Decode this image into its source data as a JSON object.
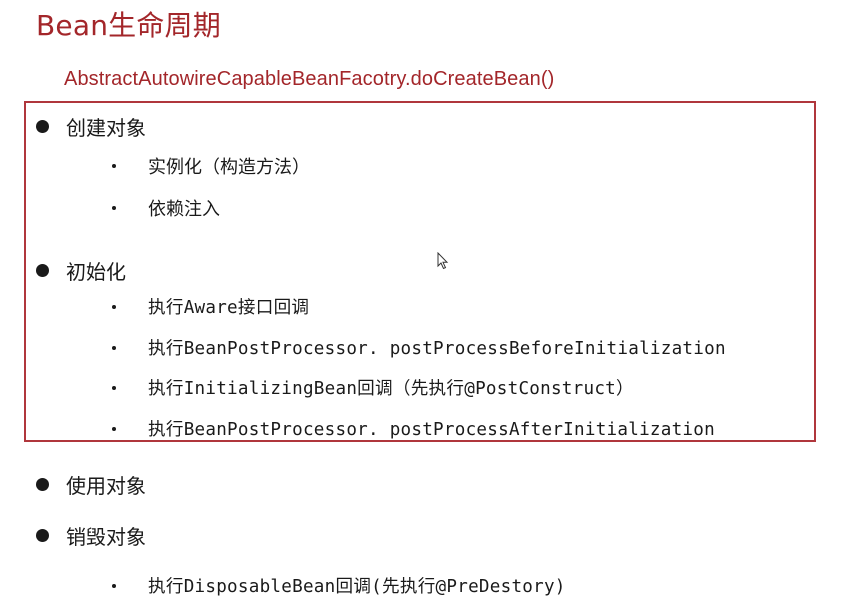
{
  "title": "Bean生命周期",
  "subtitle": "AbstractAutowireCapableBeanFacotry.doCreateBean()",
  "sections": [
    {
      "label": "创建对象",
      "items": [
        "实例化（构造方法）",
        "依赖注入"
      ]
    },
    {
      "label": "初始化",
      "items": [
        "执行Aware接口回调",
        "执行BeanPostProcessor. postProcessBeforeInitialization",
        "执行InitializingBean回调（先执行@PostConstruct）",
        "执行BeanPostProcessor. postProcessAfterInitialization"
      ]
    },
    {
      "label": "使用对象",
      "items": []
    },
    {
      "label": "销毁对象",
      "items": [
        "执行DisposableBean回调(先执行@PreDestory)"
      ]
    }
  ],
  "colors": {
    "accent": "#a3262a",
    "frame": "#b0363c",
    "text": "#1a1a1a"
  },
  "icons": {
    "cursor": "mouse-pointer-icon"
  }
}
